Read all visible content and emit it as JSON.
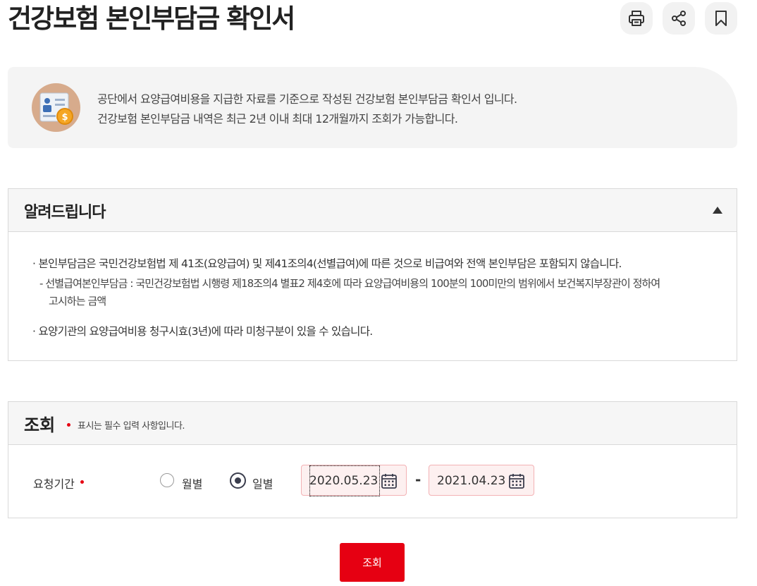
{
  "page": {
    "title": "건강보험 본인부담금 확인서",
    "actions": [
      {
        "icon": "print-icon",
        "label": "인쇄"
      },
      {
        "icon": "share-icon",
        "label": "공유"
      },
      {
        "icon": "bookmark-icon",
        "label": "즐겨찾기"
      }
    ]
  },
  "intro": {
    "icon": "document-coin-icon",
    "lines": [
      "공단에서 요양급여비용을 지급한 자료를 기준으로 작성된 건강보험 본인부담금 확인서 입니다.",
      "건강보험 본인부담금 내역은 최근 2년 이내 최대 12개월까지 조회가 가능합니다."
    ]
  },
  "notice": {
    "title": "알려드립니다",
    "collapse_icon": "caret-up-icon",
    "items": [
      "본인부담금은 국민건강보험법 제 41조(요양급여) 및 제41조의4(선별급여)에 따른 것으로 비급여와 전액 본인부담은 포함되지 않습니다.",
      "요양기관의 요양급여비용 청구시효(3년)에 따라 미청구분이 있을 수 있습니다."
    ],
    "sub_item_lines": [
      "선별급여본인부담금 : 국민건강보험법 시행령 제18조의4 별표2 제4호에 따라 요양급여비용의 100분의 100미만의 범위에서 보건복지부장관이 정하여",
      "고시하는 금액"
    ]
  },
  "search": {
    "title": "조회",
    "required_note": "표시는 필수 입력 사항입니다.",
    "period_label": "요청기간",
    "options": [
      {
        "label": "월별",
        "selected": false
      },
      {
        "label": "일별",
        "selected": true
      }
    ],
    "start_date": "2020.05.23",
    "end_date": "2021.04.23",
    "separator": "-",
    "submit_label": "조회"
  },
  "colors": {
    "accent": "#e60012",
    "date_border": "#f3b2b5",
    "date_bg": "#fdf0f0",
    "panel_bg": "#f6f6f6"
  }
}
